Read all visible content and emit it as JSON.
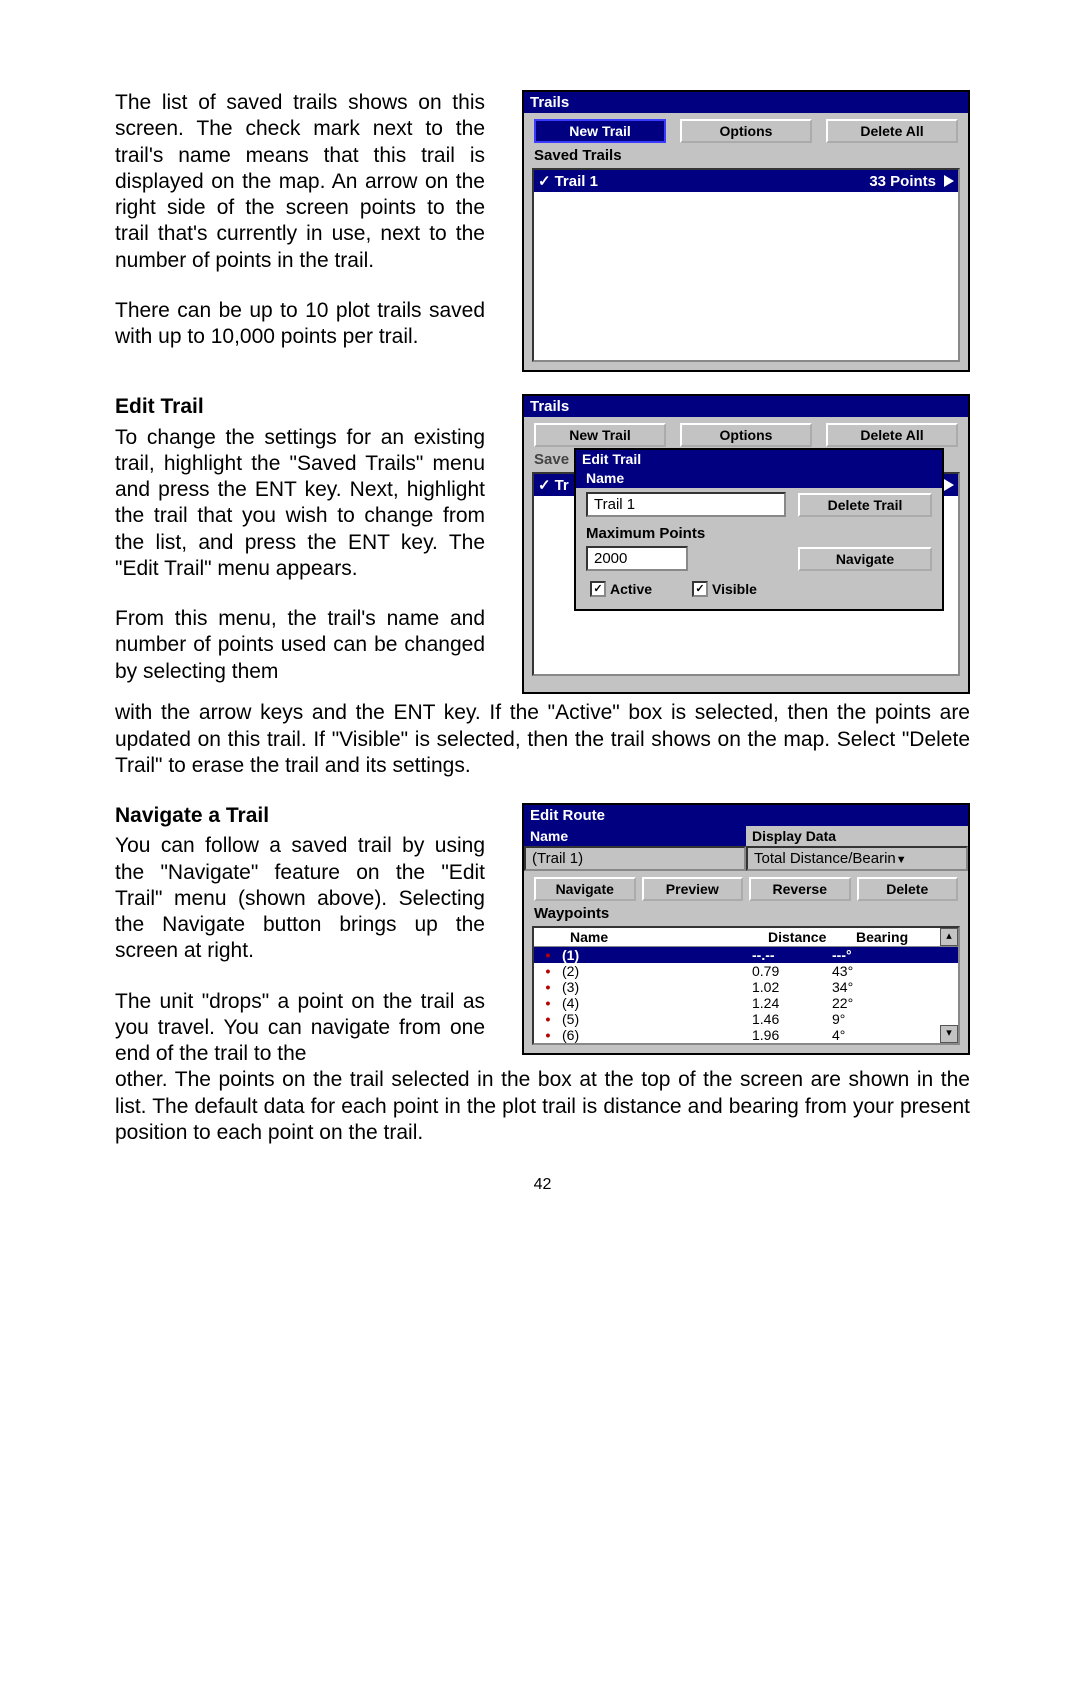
{
  "body": {
    "p1": "The list of saved trails shows on this screen. The check mark next to the trail's name means that this trail is displayed on the map. An arrow on the right side of the screen points to the trail that's currently in use, next to the number of points in the trail.",
    "p2": "There can be up to 10 plot trails saved with up to 10,000 points per trail.",
    "h1": "Edit Trail",
    "p3": "To change the settings for an existing trail, highlight the \"Saved Trails\" menu and press the ENT key. Next, highlight the trail that you wish to change from the list, and press the ENT key. The \"Edit Trail\" menu appears.",
    "p4": "From this menu, the trail's name and number of points used can be changed by selecting them",
    "p5": "with the arrow keys and the ENT key. If the \"Active\" box is selected, then the points are updated on this trail. If \"Visible\" is selected, then the trail shows on the map.  Select \"Delete Trail\" to erase the trail and its settings.",
    "h2": "Navigate a Trail",
    "p6": "You can follow a saved trail by using the \"Navigate\" feature on the \"Edit Trail\" menu (shown above). Selecting the Navigate button brings up the screen at right.",
    "p7": "The unit \"drops\" a point on the trail as you travel. You can navigate from one end of the trail to the",
    "p8": "other. The points on the trail selected in the box at the top of the screen are shown in the list. The default data for each point in the plot trail is distance and bearing from your present position to each point on the trail.",
    "page_number": "42"
  },
  "fig1": {
    "title": "Trails",
    "newTrail": "New  Trail",
    "options": "Options",
    "deleteAll": "Delete  All",
    "savedTrails": "Saved Trails",
    "trailName": "Trail 1",
    "points": "33 Points"
  },
  "fig2": {
    "title": "Trails",
    "newTrail": "New  Trail",
    "options": "Options",
    "deleteAll": "Delete  All",
    "savedPrefix": "Save",
    "rowPrefix": "Tr",
    "dlgTitle": "Edit Trail",
    "nameLabel": "Name",
    "nameValue": "Trail 1",
    "deleteTrail": "Delete  Trail",
    "maxPtsLabel": "Maximum Points",
    "maxPtsValue": "2000",
    "navigate": "Navigate",
    "active": "Active",
    "visible": "Visible"
  },
  "fig3": {
    "title": "Edit Route",
    "nameLabel": "Name",
    "nameValue": "(Trail 1)",
    "displayData": "Display Data",
    "displayValue": "Total Distance/Bearin",
    "navigate": "Navigate",
    "preview": "Preview",
    "reverse": "Reverse",
    "delete": "Delete",
    "waypoints": "Waypoints",
    "colName": "Name",
    "colDist": "Distance",
    "colBear": "Bearing",
    "rows": [
      {
        "n": "(1)",
        "d": "--.--",
        "b": "---°"
      },
      {
        "n": "(2)",
        "d": "0.79",
        "b": "43°"
      },
      {
        "n": "(3)",
        "d": "1.02",
        "b": "34°"
      },
      {
        "n": "(4)",
        "d": "1.24",
        "b": "22°"
      },
      {
        "n": "(5)",
        "d": "1.46",
        "b": "9°"
      },
      {
        "n": "(6)",
        "d": "1.96",
        "b": "4°"
      }
    ]
  }
}
